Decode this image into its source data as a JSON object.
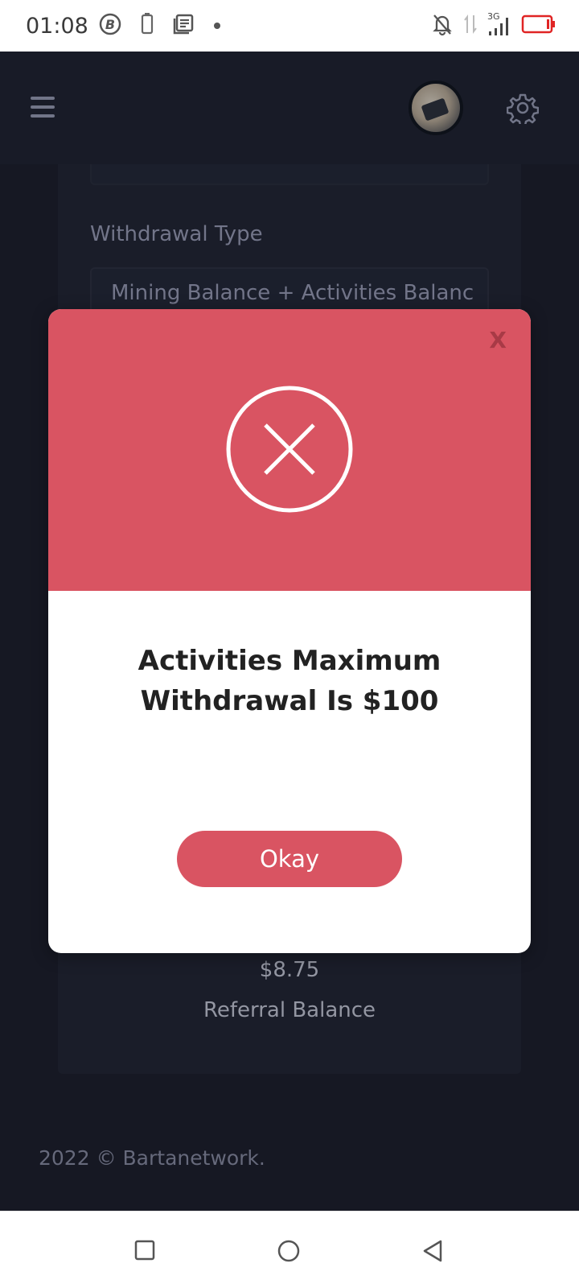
{
  "status_bar": {
    "time": "01:08",
    "network_label": "3G",
    "icons": [
      "bitcoin-icon",
      "battery-outline-icon",
      "news-icon",
      "dot-icon",
      "notifications-off-icon",
      "data-arrows-icon",
      "signal-icon",
      "battery-icon"
    ],
    "battery_color": "#e02424"
  },
  "header": {
    "icons": [
      "menu-icon",
      "avatar",
      "gear-icon"
    ]
  },
  "form": {
    "withdrawal_type_label": "Withdrawal Type",
    "withdrawal_type_value": "Mining Balance + Activities Balanc"
  },
  "balances": {
    "referral_amount": "$8.75",
    "referral_label": "Referral Balance"
  },
  "footer": {
    "text": "2022 © Bartanetwork."
  },
  "modal": {
    "close_label": "X",
    "message": "Activities Maximum Withdrawal Is $100",
    "button_label": "Okay",
    "accent_color": "#d95462",
    "icon": "error-x-icon"
  },
  "nav_bar": {
    "icons": [
      "recents-square-icon",
      "home-circle-icon",
      "back-triangle-icon"
    ]
  }
}
